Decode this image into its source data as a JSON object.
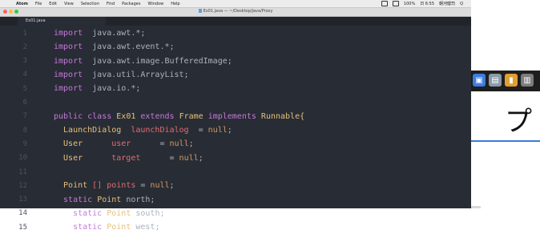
{
  "menubar": {
    "items": [
      "File",
      "Edit",
      "View",
      "Selection",
      "Find",
      "Packages",
      "Window",
      "Help"
    ],
    "app_name": "Atom",
    "status_items": [
      "100%",
      "日 6:55",
      "朝河健司",
      "Q"
    ]
  },
  "window": {
    "title": "Ex01.java — ~/Desktop/Java/Proxy",
    "tab_label": "Ex01.java"
  },
  "background": {
    "japanese_char": "プ"
  },
  "editor": {
    "lines": [
      {
        "n": "1",
        "tokens": [
          [
            "import",
            "kw"
          ],
          [
            "  java.awt.*;",
            "pl"
          ]
        ]
      },
      {
        "n": "2",
        "tokens": [
          [
            "import",
            "kw"
          ],
          [
            "  java.awt.event.*;",
            "pl"
          ]
        ]
      },
      {
        "n": "3",
        "tokens": [
          [
            "import",
            "kw"
          ],
          [
            "  java.awt.image.BufferedImage;",
            "pl"
          ]
        ]
      },
      {
        "n": "4",
        "tokens": [
          [
            "import",
            "kw"
          ],
          [
            "  java.util.ArrayList;",
            "pl"
          ]
        ]
      },
      {
        "n": "5",
        "tokens": [
          [
            "import",
            "kw"
          ],
          [
            "  java.io.*;",
            "pl"
          ]
        ]
      },
      {
        "n": "6",
        "tokens": []
      },
      {
        "n": "7",
        "tokens": [
          [
            "public class ",
            "kw"
          ],
          [
            "Ex01 ",
            "ty"
          ],
          [
            "extends ",
            "kw"
          ],
          [
            "Frame ",
            "ty"
          ],
          [
            "implements ",
            "kw"
          ],
          [
            "Runnable{",
            "ty"
          ]
        ]
      },
      {
        "n": "8",
        "tokens": [
          [
            "  LaunchDialog  ",
            "ty"
          ],
          [
            "launchDialog",
            "vr"
          ],
          [
            "  = ",
            "pl"
          ],
          [
            "null",
            "nu"
          ],
          [
            ";",
            "pl"
          ]
        ]
      },
      {
        "n": "9",
        "tokens": [
          [
            "  User      ",
            "ty"
          ],
          [
            "user",
            "vr"
          ],
          [
            "      = ",
            "pl"
          ],
          [
            "null",
            "nu"
          ],
          [
            ";",
            "pl"
          ]
        ]
      },
      {
        "n": "10",
        "tokens": [
          [
            "  User      ",
            "ty"
          ],
          [
            "target",
            "vr"
          ],
          [
            "      = ",
            "pl"
          ],
          [
            "null",
            "nu"
          ],
          [
            ";",
            "pl"
          ]
        ]
      },
      {
        "n": "11",
        "tokens": []
      },
      {
        "n": "12",
        "tokens": [
          [
            "  Point ",
            "ty"
          ],
          [
            "[] ",
            "vr"
          ],
          [
            "points",
            "vr"
          ],
          [
            " = ",
            "pl"
          ],
          [
            "null",
            "nu"
          ],
          [
            ";",
            "pl"
          ]
        ]
      },
      {
        "n": "13",
        "tokens": [
          [
            "  static ",
            "kw"
          ],
          [
            "Point ",
            "ty"
          ],
          [
            "north;",
            "pl"
          ]
        ]
      },
      {
        "n": "14",
        "tokens": [
          [
            "    static ",
            "kw"
          ],
          [
            "Point ",
            "ty"
          ],
          [
            "south;",
            "pl"
          ]
        ]
      },
      {
        "n": "15",
        "tokens": [
          [
            "    static ",
            "kw"
          ],
          [
            "Point ",
            "ty"
          ],
          [
            "west;",
            "pl"
          ]
        ]
      }
    ]
  }
}
